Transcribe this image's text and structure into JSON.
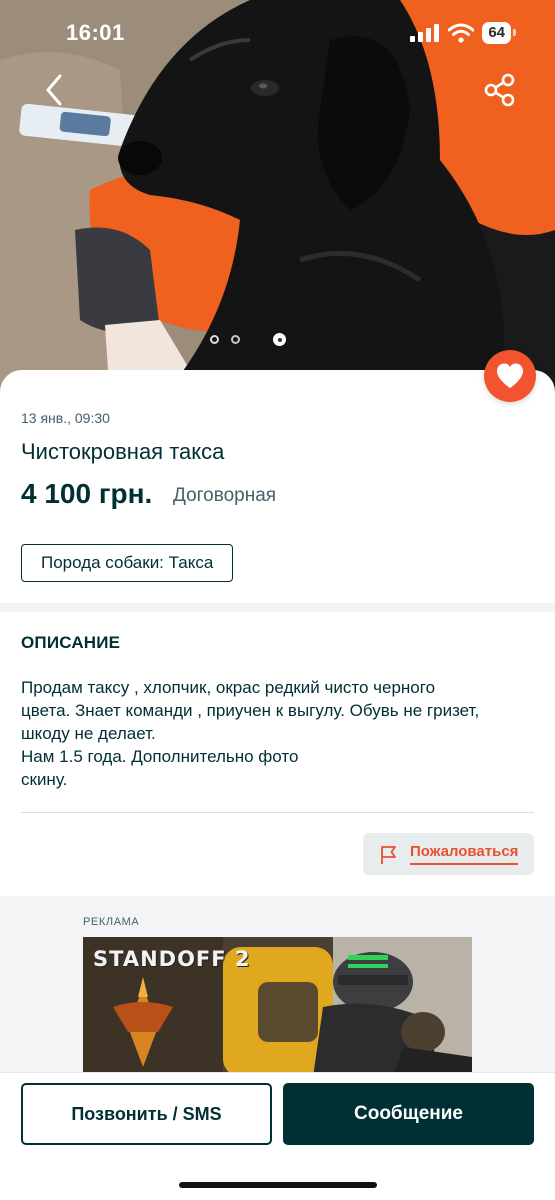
{
  "status_bar": {
    "time": "16:01",
    "battery": "64"
  },
  "photo": {
    "description_icon_back": "chevron-left-icon",
    "description_icon_share": "share-icon",
    "carousel": {
      "count": 4,
      "active_index": 3
    }
  },
  "listing": {
    "date": "13 янв., 09:30",
    "title": "Чистокровная такса",
    "price": "4 100 грн.",
    "negotiable": "Договорная",
    "tag": "Порода собаки: Такса"
  },
  "description": {
    "heading": "ОПИСАНИЕ",
    "text": "Продам таксу , хлопчик, окрас редкий чисто черного\nцвета. Знает команди , приучен к выгулу. Обувь не гризет,\nшкоду не делает.\nНам 1.5 года. Дополнительно фото\nскину."
  },
  "report": {
    "label": "Пожаловаться",
    "icon": "flag-icon"
  },
  "ad": {
    "label": "РЕКЛАМА",
    "brand": "STANDOFF 2"
  },
  "actions": {
    "call_label": "Позвонить / SMS",
    "message_label": "Сообщение"
  },
  "colors": {
    "accent": "#f2542f",
    "primary": "#002f34",
    "report": "#e8512d"
  }
}
